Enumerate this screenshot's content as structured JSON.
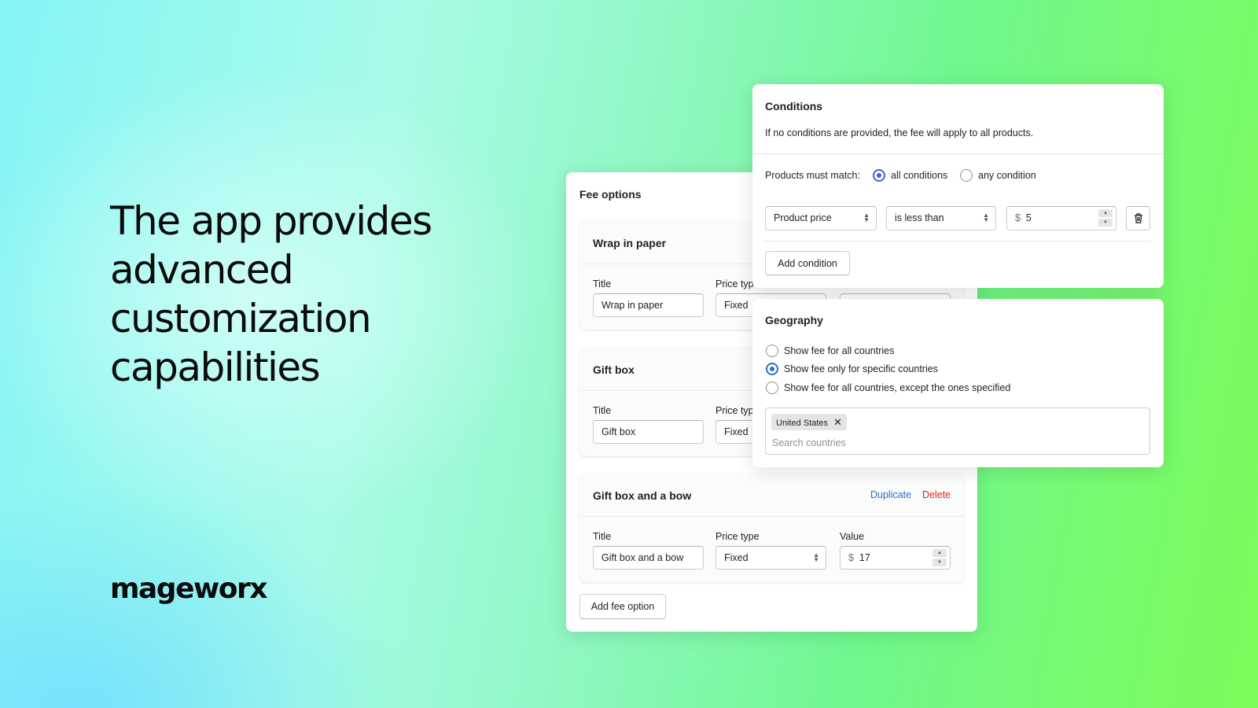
{
  "headline": [
    "The app provides",
    "advanced",
    "customization",
    "capabilities"
  ],
  "logo": "mageworx",
  "fee": {
    "title": "Fee options",
    "title_label": "Title",
    "price_type_label": "Price type",
    "value_label": "Value",
    "options": [
      {
        "name": "Wrap in paper",
        "title": "Wrap in paper",
        "price_type": "Fixed"
      },
      {
        "name": "Gift box",
        "title": "Gift box",
        "price_type": "Fixed"
      },
      {
        "name": "Gift box and a bow",
        "title": "Gift box and a bow",
        "price_type": "Fixed",
        "currency": "$",
        "value": "17",
        "duplicate": "Duplicate",
        "delete": "Delete"
      }
    ],
    "add": "Add fee option"
  },
  "conditions": {
    "title": "Conditions",
    "desc": "If no conditions are provided, the fee will apply to all products.",
    "match_label": "Products must match:",
    "all": "all conditions",
    "any": "any condition",
    "selected": "all conditions",
    "field": "Product price",
    "operator": "is less than",
    "currency": "$",
    "value": "5",
    "add": "Add condition"
  },
  "geography": {
    "title": "Geography",
    "options": [
      "Show fee for all countries",
      "Show fee only for specific countries",
      "Show fee for all countries, except the ones specified"
    ],
    "selected": "Show fee only for specific countries",
    "chip": "United States",
    "search_placeholder": "Search countries"
  },
  "colors": {
    "accent": "#2c6ecb",
    "danger": "#d72c0d"
  }
}
